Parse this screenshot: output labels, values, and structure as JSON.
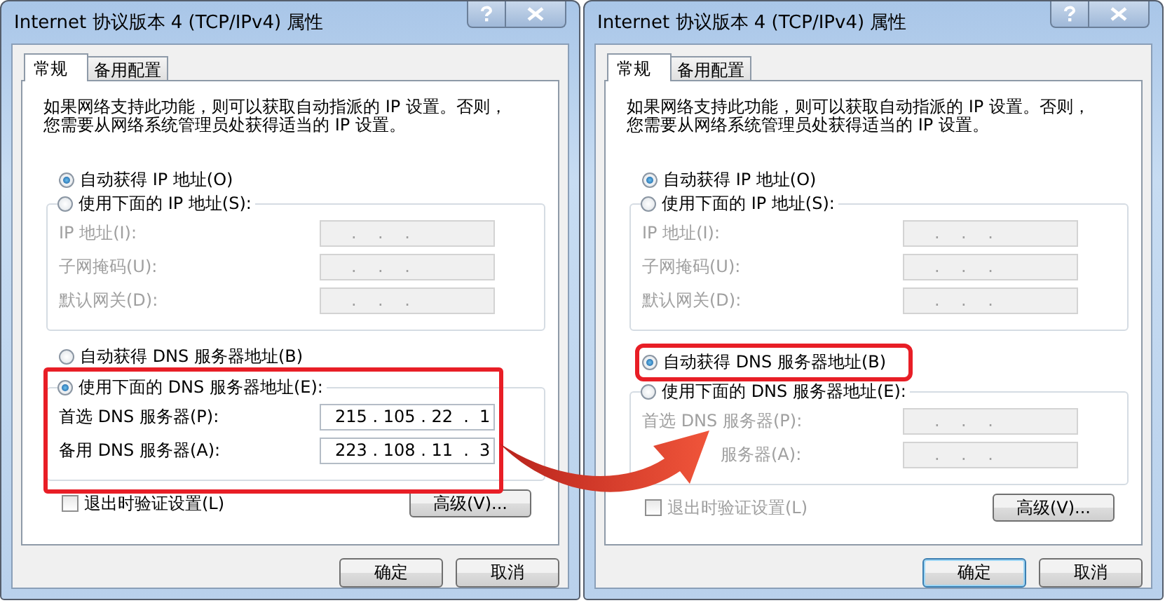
{
  "dialogs": [
    {
      "title": "Internet 协议版本 4 (TCP/IPv4) 属性",
      "tabs": [
        {
          "label": "常规",
          "selected": true
        },
        {
          "label": "备用配置",
          "selected": false
        }
      ],
      "description": [
        "如果网络支持此功能，则可以获取自动指派的 IP 设置。否则，",
        "您需要从网络系统管理员处获得适当的 IP 设置。"
      ],
      "ip_radios": [
        {
          "label": "自动获得 IP 地址(O)",
          "selected": true
        },
        {
          "label": "使用下面的 IP 地址(S):",
          "selected": false
        }
      ],
      "ip_fields": [
        {
          "label": "IP 地址(I):",
          "value": "   .    .    .",
          "disabled": true
        },
        {
          "label": "子网掩码(U):",
          "value": "   .    .    .",
          "disabled": true
        },
        {
          "label": "默认网关(D):",
          "value": "   .    .    .",
          "disabled": true
        }
      ],
      "dns_radios": [
        {
          "label": "自动获得 DNS 服务器地址(B)",
          "selected": false,
          "highlighted": false
        },
        {
          "label": "使用下面的 DNS 服务器地址(E):",
          "selected": true,
          "highlighted": true
        }
      ],
      "dns_fields": [
        {
          "label": "首选 DNS 服务器(P):",
          "value": "215 . 105 . 22  .  1",
          "disabled": false,
          "partly_hidden": false
        },
        {
          "label": "备用 DNS 服务器(A):",
          "value": "223 . 108 . 11  .  3",
          "disabled": false,
          "partly_hidden": false
        }
      ],
      "checkbox": {
        "label": "退出时验证设置(L)",
        "checked": false,
        "disabled": false
      },
      "advanced_button": "高级(V)...",
      "ok_button": {
        "label": "确定",
        "default": false
      },
      "cancel_button": "取消"
    },
    {
      "title": "Internet 协议版本 4 (TCP/IPv4) 属性",
      "tabs": [
        {
          "label": "常规",
          "selected": true
        },
        {
          "label": "备用配置",
          "selected": false
        }
      ],
      "description": [
        "如果网络支持此功能，则可以获取自动指派的 IP 设置。否则，",
        "您需要从网络系统管理员处获得适当的 IP 设置。"
      ],
      "ip_radios": [
        {
          "label": "自动获得 IP 地址(O)",
          "selected": true
        },
        {
          "label": "使用下面的 IP 地址(S):",
          "selected": false
        }
      ],
      "ip_fields": [
        {
          "label": "IP 地址(I):",
          "value": "   .    .    .",
          "disabled": true
        },
        {
          "label": "子网掩码(U):",
          "value": "   .    .    .",
          "disabled": true
        },
        {
          "label": "默认网关(D):",
          "value": "   .    .    .",
          "disabled": true
        }
      ],
      "dns_radios": [
        {
          "label": "自动获得 DNS 服务器地址(B)",
          "selected": true,
          "highlighted": true
        },
        {
          "label": "使用下面的 DNS 服务器地址(E):",
          "selected": false,
          "highlighted": false
        }
      ],
      "dns_fields": [
        {
          "label": "首选 DNS 服务器(P):",
          "value": "   .    .    .",
          "disabled": true,
          "partly_hidden": false
        },
        {
          "label": "服务器(A):",
          "value": "   .    .    .",
          "disabled": true,
          "partly_hidden": true
        }
      ],
      "checkbox": {
        "label": "退出时验证设置(L)",
        "checked": false,
        "disabled": true
      },
      "advanced_button": "高级(V)...",
      "ok_button": {
        "label": "确定",
        "default": true
      },
      "cancel_button": "取消"
    }
  ]
}
